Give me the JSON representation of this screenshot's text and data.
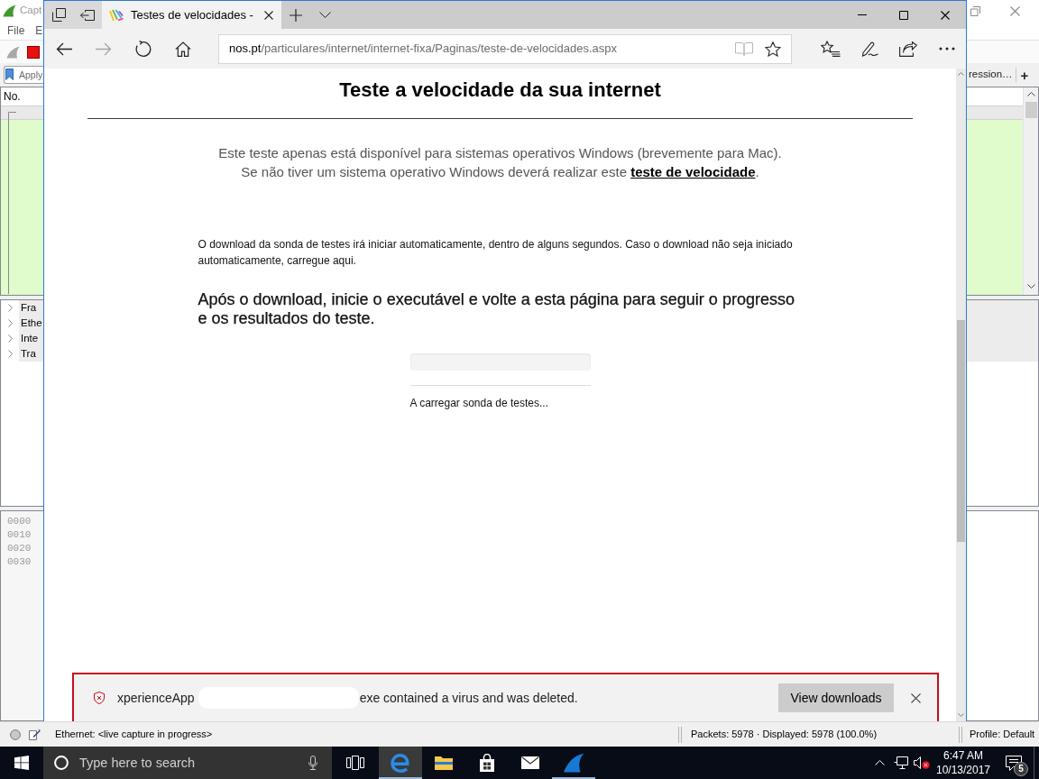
{
  "desktop_window": {
    "title": "Capt",
    "menu": [
      "File",
      "E"
    ],
    "filter": {
      "placeholder": "Apply"
    },
    "expression_button": "ression…",
    "add_button": "+",
    "packet_list": {
      "columns": [
        "No."
      ]
    },
    "packet_details": [
      {
        "label": "Fra",
        "expanded": false
      },
      {
        "label": "Ethe",
        "expanded": false
      },
      {
        "label": "Inte",
        "expanded": false
      },
      {
        "label": "Tra",
        "expanded": false
      }
    ],
    "packet_bytes": [
      "0000",
      "0010",
      "0020",
      "0030"
    ],
    "status_bar": {
      "capture": "Ethernet: <live capture in progress>",
      "counts": "Packets: 5978 · Displayed: 5978 (100.0%)",
      "profile": "Profile: Default"
    }
  },
  "browser": {
    "tabs": [
      {
        "title": "Testes de velocidades -",
        "selected": true
      }
    ],
    "nav_buttons": [
      {
        "kind": "back",
        "disabled": false
      },
      {
        "kind": "forward",
        "disabled": true
      },
      {
        "kind": "refresh",
        "disabled": false
      },
      {
        "kind": "home",
        "disabled": false
      }
    ],
    "address": {
      "host": "nos.pt",
      "path": "/particulares/internet/internet-fixa/Paginas/teste-de-velocidades.aspx"
    },
    "address_buttons": [
      {
        "kind": "reading-view",
        "disabled": true
      },
      {
        "kind": "favorite",
        "disabled": false
      }
    ],
    "page": {
      "heading": "Teste a velocidade da sua internet",
      "notice": [
        {
          "text": "Este teste apenas está disponível para sistemas operativos Windows (brevemente para Mac)."
        },
        {
          "text": "Se não tiver um sistema operativo Windows deverá realizar este ",
          "link": "teste de velocidade",
          "after": "."
        }
      ],
      "download_note": "O download da sonda de testes irá iniciar automaticamente, dentro de alguns segundos. Caso o download não seja iniciado automaticamente, carregue aqui.",
      "instructions": "Após o download, inicie o executável e volte a esta página para seguir o progresso e os resultados do teste.",
      "progress": {
        "level": 0
      },
      "status": "A carregar sonda de testes..."
    },
    "download_bar": {
      "file_name": "xperienceApp",
      "message": "exe contained a virus and was deleted.",
      "button": "View downloads"
    }
  },
  "taskbar": {
    "search": {
      "placeholder": "Type here to search"
    },
    "apps": [
      {
        "kind": "browser",
        "selected": true,
        "running": true
      },
      {
        "kind": "files",
        "selected": false,
        "running": false
      },
      {
        "kind": "store",
        "selected": false,
        "running": false
      },
      {
        "kind": "mail",
        "selected": false,
        "running": false
      },
      {
        "kind": "capture",
        "selected": false,
        "running": true
      }
    ],
    "tray": {
      "volume_muted": true
    },
    "clock": {
      "time": "6:47 AM",
      "date": "10/13/2017"
    },
    "notifications": "5"
  }
}
